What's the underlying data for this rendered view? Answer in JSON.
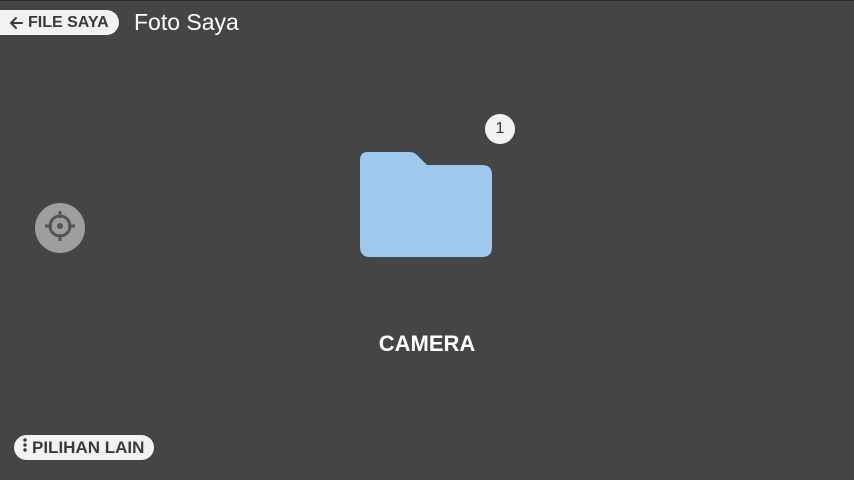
{
  "header": {
    "back_label": "FILE SAYA",
    "back_icon": "arrow-left-icon",
    "title": "Foto Saya"
  },
  "controls": {
    "locate_icon": "crosshair-icon"
  },
  "folder": {
    "name": "CAMERA",
    "count": "1",
    "icon": "folder-icon",
    "color": "#9fc9ec"
  },
  "footer": {
    "more_label": "PILIHAN LAIN",
    "more_icon": "more-vertical-icon"
  },
  "colors": {
    "background": "#454545",
    "pill": "#f2f2f2",
    "pill_text": "#3a3a3a",
    "control": "#9e9e9e"
  }
}
